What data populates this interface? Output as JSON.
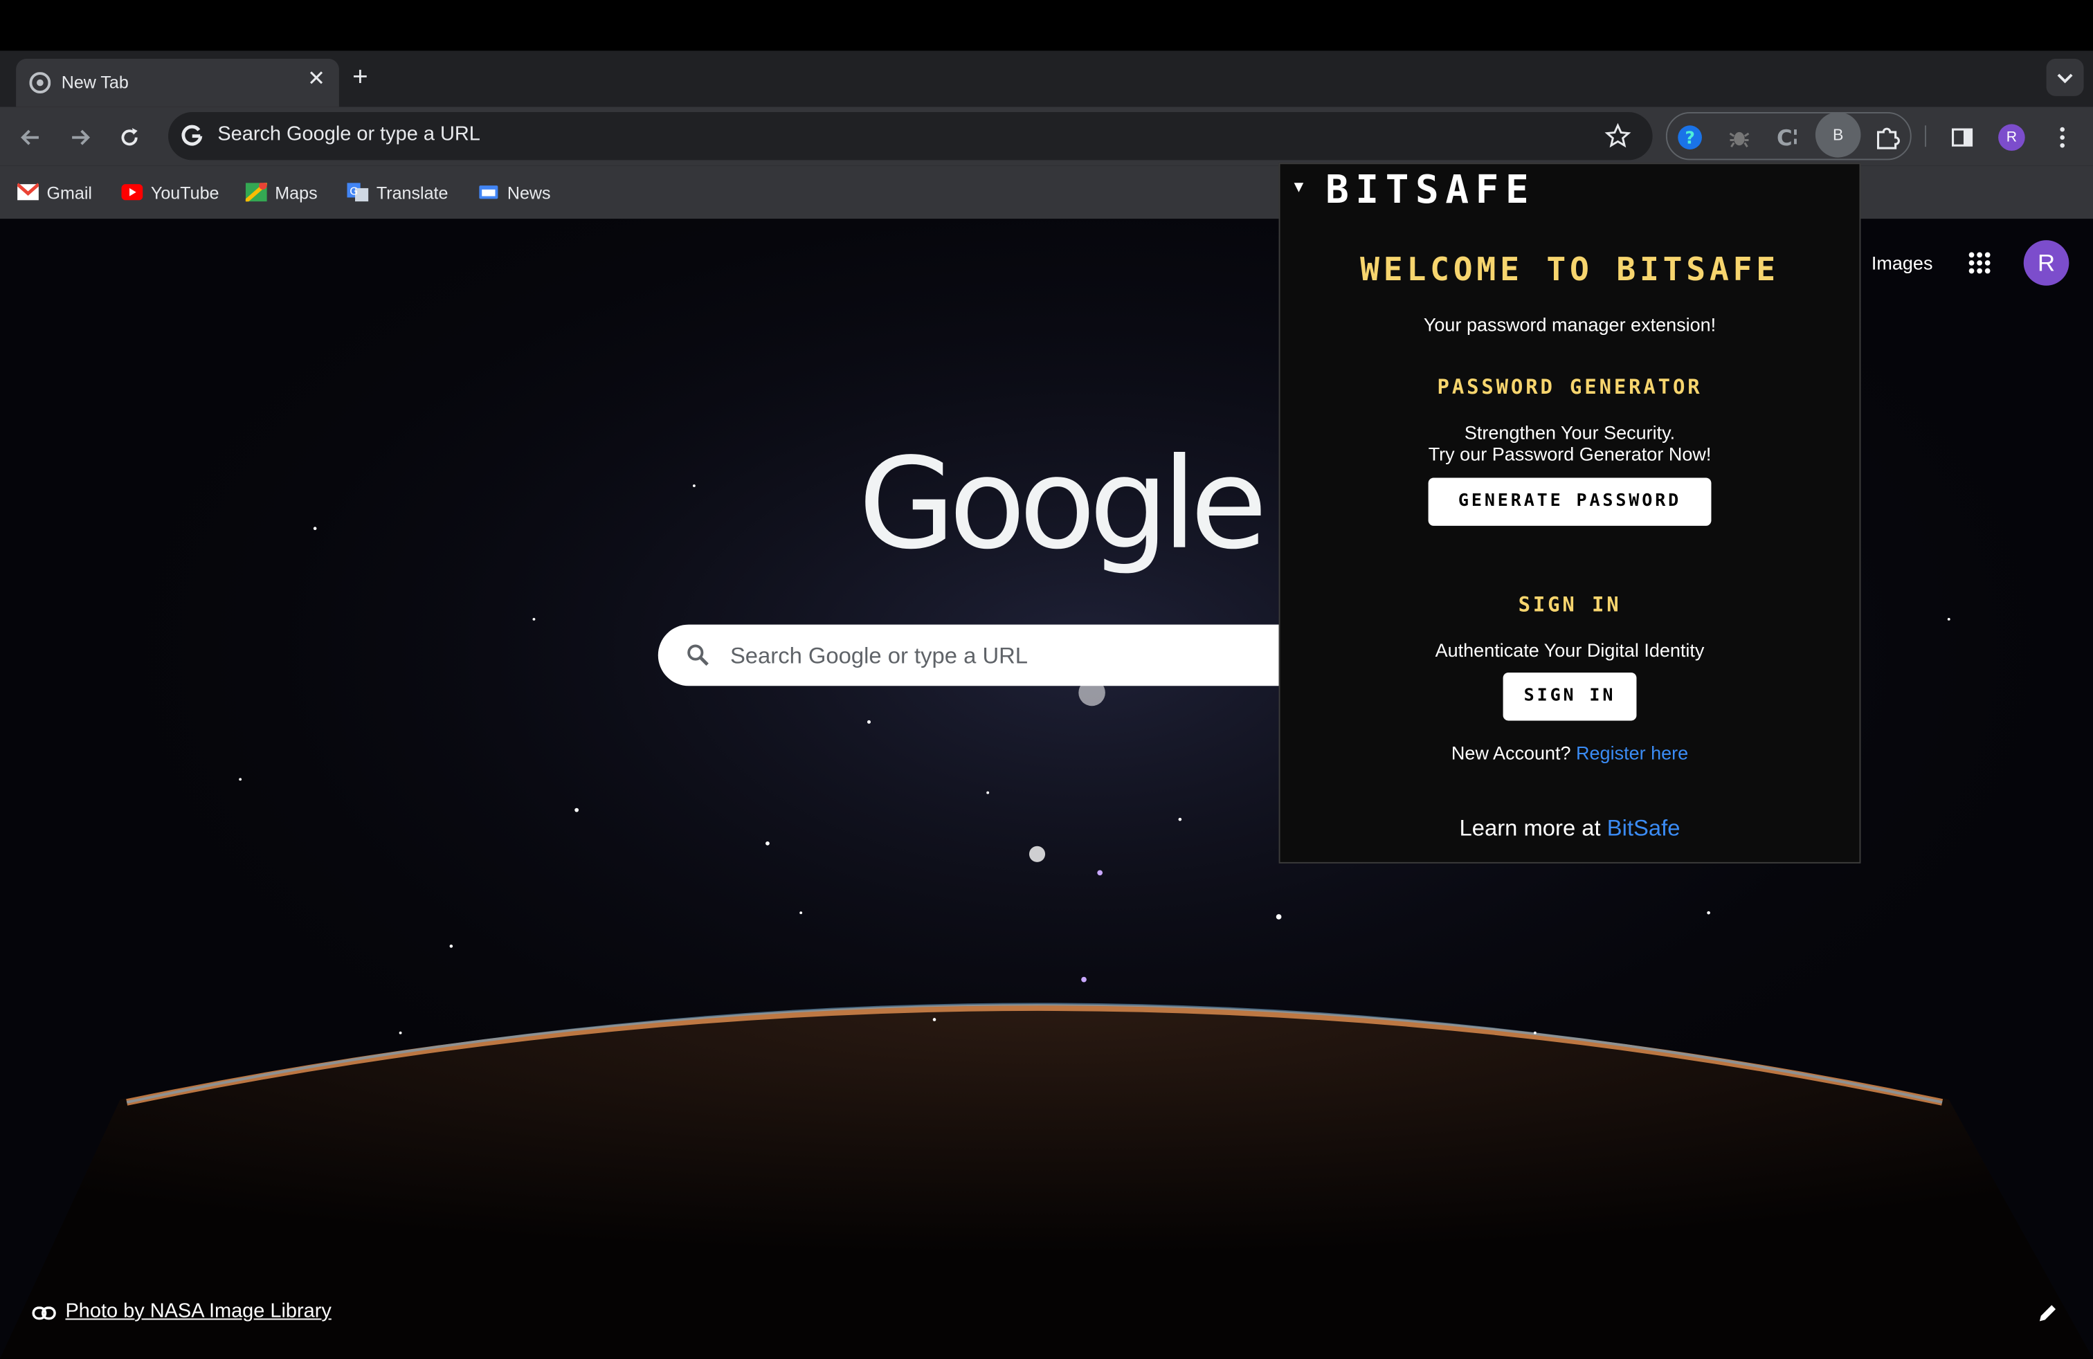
{
  "browser": {
    "tab_title": "New Tab",
    "tab_close": "✕",
    "new_tab": "+",
    "omnibox_placeholder": "Search Google or type a URL",
    "profile_initial": "R",
    "extension_initial": "B"
  },
  "bookmarks": [
    {
      "label": "Gmail",
      "icon": "gmail-icon"
    },
    {
      "label": "YouTube",
      "icon": "youtube-icon"
    },
    {
      "label": "Maps",
      "icon": "maps-icon"
    },
    {
      "label": "Translate",
      "icon": "translate-icon"
    },
    {
      "label": "News",
      "icon": "news-icon"
    }
  ],
  "newtab": {
    "logo_text": "Google",
    "search_placeholder": "Search Google or type a URL",
    "images_link": "Images",
    "profile_initial": "R",
    "photo_credit": "Photo by NASA Image Library"
  },
  "popup": {
    "collapse_glyph": "▼",
    "brand": "BITSAFE",
    "welcome": "WELCOME TO BITSAFE",
    "subtitle": "Your password manager extension!",
    "generator_heading": "PASSWORD GENERATOR",
    "generator_line1": "Strengthen Your Security.",
    "generator_line2": "Try our Password Generator Now!",
    "generate_button": "GENERATE PASSWORD",
    "signin_heading": "SIGN IN",
    "signin_text": "Authenticate Your Digital Identity",
    "signin_button": "SIGN IN",
    "register_prefix": "New Account?",
    "register_link": "Register here",
    "learn_prefix": "Learn more at",
    "learn_link": "BitSafe"
  },
  "colors": {
    "accent_yellow": "#f7d56e",
    "link_blue": "#3b8cf5",
    "profile_purple": "#7c4dcc",
    "chrome_dark": "#35363a"
  }
}
